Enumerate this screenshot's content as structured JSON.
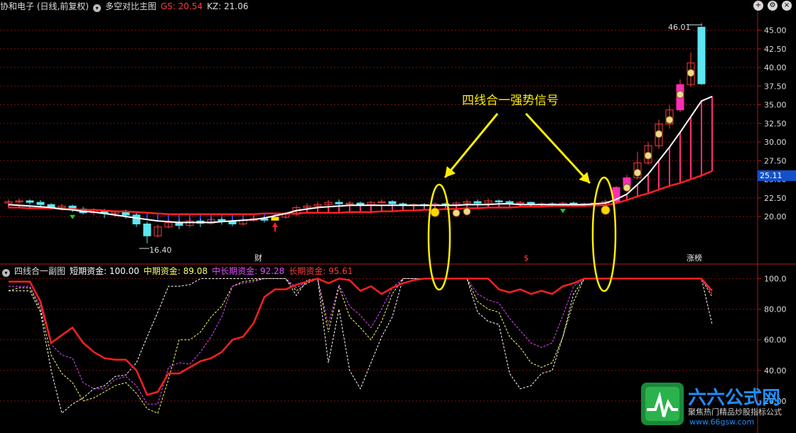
{
  "main_header": {
    "title": "协和电子 (日线,前复权)",
    "indicator": "多空对比主图",
    "gs_label": "GS: 20.54",
    "kz_label": "KZ: 21.06"
  },
  "sub_header": {
    "title": "四线合一副图",
    "short": "短期资金: 100.00",
    "mid": "中期资金: 89.08",
    "midlong": "中长期资金: 92.28",
    "long": "长期资金: 95.61"
  },
  "annotations": {
    "signal": "四线合一强势信号",
    "high": "46.01",
    "low": "16.40",
    "current_price": "25.11",
    "event_cai": "财",
    "event_s": "$",
    "event_zhangbang": "涨榜"
  },
  "watermark": {
    "brand": "六六公式网",
    "slogan": "聚焦热门精品炒股指标公式",
    "url": "www.66gsw.com"
  },
  "colors": {
    "bg": "#000000",
    "up": "#ff3b3b",
    "down": "#5ce6f2",
    "ma_white": "#ffffff",
    "ma_red": "#ff2020",
    "short": "#ff2020",
    "mid": "#ffff66",
    "midlong": "#e64cff",
    "long": "#ffffff",
    "annot": "#ffee00",
    "grid": "#7a1010"
  },
  "chart_data": [
    {
      "type": "candlestick",
      "title": "多空对比主图",
      "ylim": [
        15,
        48
      ],
      "yticks": [
        "20.00",
        "22.50",
        "25.00",
        "27.50",
        "30.00",
        "32.50",
        "35.00",
        "37.50",
        "40.00",
        "42.50",
        "45.00"
      ],
      "candles": [
        [
          21.8,
          22.0,
          22.3,
          21.5
        ],
        [
          22.0,
          22.1,
          22.4,
          21.7
        ],
        [
          22.1,
          21.9,
          22.3,
          21.6
        ],
        [
          21.9,
          21.6,
          22.2,
          21.3
        ],
        [
          21.6,
          21.2,
          21.8,
          20.9
        ],
        [
          21.2,
          21.4,
          21.7,
          20.8
        ],
        [
          21.4,
          21.0,
          21.6,
          20.6
        ],
        [
          21.0,
          20.5,
          21.3,
          20.3
        ],
        [
          20.5,
          20.8,
          21.1,
          20.2
        ],
        [
          20.8,
          20.4,
          21.0,
          19.8
        ],
        [
          20.4,
          20.6,
          20.8,
          19.9
        ],
        [
          20.6,
          20.2,
          20.9,
          19.7
        ],
        [
          20.2,
          19.0,
          20.4,
          18.6
        ],
        [
          19.0,
          17.4,
          19.3,
          16.4
        ],
        [
          17.4,
          18.6,
          18.9,
          17.2
        ],
        [
          18.6,
          19.2,
          19.6,
          18.4
        ],
        [
          19.2,
          18.8,
          19.5,
          18.3
        ],
        [
          18.8,
          19.4,
          19.8,
          18.5
        ],
        [
          19.4,
          19.1,
          19.7,
          18.6
        ],
        [
          19.1,
          19.6,
          19.9,
          18.9
        ],
        [
          19.6,
          19.3,
          19.8,
          18.9
        ],
        [
          19.3,
          19.0,
          19.6,
          18.7
        ],
        [
          19.0,
          19.5,
          19.8,
          18.8
        ],
        [
          19.5,
          19.7,
          20.1,
          19.3
        ],
        [
          19.7,
          19.5,
          20.0,
          19.2
        ],
        [
          19.5,
          19.9,
          20.2,
          19.4
        ],
        [
          19.9,
          20.3,
          20.6,
          19.7
        ],
        [
          20.3,
          21.2,
          21.5,
          20.1
        ],
        [
          21.2,
          21.4,
          21.8,
          20.9
        ],
        [
          21.4,
          21.6,
          22.0,
          21.2
        ],
        [
          21.6,
          21.9,
          22.2,
          21.4
        ],
        [
          21.9,
          21.7,
          22.3,
          21.5
        ],
        [
          21.7,
          21.8,
          22.1,
          21.5
        ],
        [
          21.8,
          21.6,
          22.0,
          21.4
        ],
        [
          21.6,
          21.9,
          22.1,
          21.5
        ],
        [
          21.9,
          22.0,
          22.3,
          21.7
        ],
        [
          22.0,
          21.7,
          22.2,
          21.5
        ],
        [
          21.7,
          21.5,
          21.9,
          21.3
        ],
        [
          21.5,
          21.6,
          21.8,
          21.3
        ],
        [
          21.6,
          21.5,
          21.8,
          21.3
        ],
        [
          21.5,
          21.7,
          21.9,
          21.3
        ],
        [
          21.7,
          21.6,
          21.9,
          21.4
        ],
        [
          21.6,
          21.8,
          22.0,
          21.4
        ],
        [
          21.8,
          22.0,
          22.3,
          21.6
        ],
        [
          22.0,
          21.8,
          22.3,
          21.5
        ],
        [
          21.8,
          22.1,
          22.4,
          21.6
        ],
        [
          22.1,
          22.0,
          22.3,
          21.8
        ],
        [
          22.0,
          21.8,
          22.2,
          21.6
        ],
        [
          21.8,
          21.9,
          22.1,
          21.6
        ],
        [
          21.9,
          21.6,
          22.0,
          21.4
        ],
        [
          21.6,
          21.7,
          21.9,
          21.4
        ],
        [
          21.7,
          21.6,
          21.9,
          21.4
        ],
        [
          21.6,
          21.8,
          22.0,
          21.4
        ],
        [
          21.8,
          21.6,
          22.0,
          21.4
        ],
        [
          21.6,
          21.7,
          21.9,
          21.5
        ],
        [
          21.7,
          21.8,
          22.0,
          21.5
        ],
        [
          21.8,
          22.0,
          22.3,
          21.6
        ],
        [
          22.0,
          23.9,
          24.1,
          21.9
        ],
        [
          23.9,
          25.2,
          25.6,
          23.4
        ],
        [
          25.2,
          27.2,
          28.7,
          25.0
        ],
        [
          27.2,
          29.5,
          30.0,
          26.9
        ],
        [
          29.5,
          32.4,
          33.0,
          29.1
        ],
        [
          32.4,
          34.3,
          34.9,
          31.8
        ],
        [
          34.3,
          37.7,
          38.4,
          34.0
        ],
        [
          37.7,
          40.6,
          42.0,
          37.4
        ],
        [
          37.8,
          45.4,
          46.01,
          37.6
        ]
      ],
      "ma_white": [
        21.6,
        21.5,
        21.4,
        21.3,
        21.2,
        21.0,
        20.9,
        20.7,
        20.6,
        20.4,
        20.2,
        20.0,
        19.8,
        19.6,
        19.4,
        19.3,
        19.2,
        19.2,
        19.2,
        19.2,
        19.3,
        19.4,
        19.5,
        19.6,
        19.8,
        20.1,
        20.4,
        20.8,
        21.0,
        21.2,
        21.3,
        21.4,
        21.5,
        21.5,
        21.5,
        21.5,
        21.5,
        21.5,
        21.5,
        21.5,
        21.5,
        21.5,
        21.5,
        21.6,
        21.6,
        21.6,
        21.7,
        21.7,
        21.6,
        21.6,
        21.6,
        21.6,
        21.6,
        21.6,
        21.6,
        21.7,
        21.8,
        22.3,
        23.0,
        24.3,
        25.7,
        27.5,
        29.3,
        31.3,
        33.4,
        35.5,
        36.1
      ],
      "ma_red": [
        21.2,
        21.2,
        21.1,
        21.1,
        21.1,
        21.0,
        21.0,
        20.9,
        20.9,
        20.8,
        20.7,
        20.7,
        20.6,
        20.5,
        20.4,
        20.3,
        20.3,
        20.3,
        20.3,
        20.3,
        20.3,
        20.3,
        20.3,
        20.3,
        20.4,
        20.4,
        20.4,
        20.4,
        20.5,
        20.5,
        20.5,
        20.5,
        20.6,
        20.6,
        20.6,
        20.7,
        20.7,
        20.8,
        20.8,
        20.9,
        20.9,
        21.0,
        21.0,
        21.1,
        21.1,
        21.2,
        21.2,
        21.2,
        21.3,
        21.3,
        21.3,
        21.4,
        21.4,
        21.4,
        21.4,
        21.5,
        21.5,
        21.8,
        22.2,
        22.7,
        23.1,
        23.6,
        24.1,
        24.5,
        25.0,
        25.5,
        26.1
      ]
    },
    {
      "type": "line",
      "title": "四线合一副图",
      "ylim": [
        0,
        110
      ],
      "yticks": [
        "20.00",
        "40.00",
        "60.00",
        "80.00",
        "100.0"
      ],
      "series": [
        {
          "name": "短期资金",
          "values": [
            98,
            98,
            98,
            85,
            58,
            63,
            68,
            58,
            52,
            48,
            47,
            47,
            40,
            24,
            26,
            38,
            38,
            42,
            46,
            48,
            52,
            60,
            62,
            71,
            88,
            93,
            93,
            96,
            98,
            100,
            97,
            100,
            99,
            92,
            95,
            90,
            94,
            97,
            99,
            100,
            100,
            100,
            100,
            100,
            100,
            100,
            93,
            91,
            93,
            90,
            92,
            90,
            95,
            97,
            100,
            100,
            100,
            100,
            100,
            100,
            100,
            100,
            100,
            100,
            100,
            100,
            92
          ]
        },
        {
          "name": "中期资金",
          "values": [
            92,
            94,
            94,
            80,
            50,
            38,
            32,
            20,
            22,
            26,
            30,
            32,
            25,
            15,
            12,
            34,
            60,
            60,
            65,
            75,
            82,
            95,
            98,
            99,
            100,
            100,
            100,
            92,
            97,
            100,
            65,
            95,
            75,
            68,
            60,
            72,
            90,
            100,
            100,
            100,
            100,
            100,
            100,
            100,
            85,
            80,
            78,
            62,
            55,
            45,
            42,
            45,
            62,
            85,
            100,
            100,
            100,
            100,
            100,
            100,
            100,
            100,
            100,
            100,
            100,
            100,
            88
          ]
        },
        {
          "name": "中长期资金",
          "values": [
            95,
            95,
            95,
            82,
            57,
            50,
            48,
            32,
            28,
            28,
            34,
            36,
            30,
            18,
            18,
            42,
            45,
            44,
            52,
            62,
            75,
            95,
            97,
            98,
            100,
            100,
            100,
            94,
            98,
            100,
            70,
            96,
            82,
            76,
            68,
            80,
            94,
            100,
            100,
            100,
            100,
            100,
            100,
            100,
            90,
            86,
            84,
            74,
            66,
            58,
            55,
            58,
            76,
            95,
            100,
            100,
            100,
            100,
            100,
            100,
            100,
            100,
            100,
            100,
            100,
            100,
            90
          ]
        },
        {
          "name": "长期资金",
          "values": [
            92,
            92,
            92,
            78,
            40,
            12,
            18,
            22,
            28,
            30,
            36,
            37,
            45,
            62,
            78,
            95,
            95,
            96,
            100,
            100,
            100,
            100,
            100,
            100,
            100,
            100,
            100,
            89,
            99,
            100,
            45,
            80,
            40,
            28,
            45,
            62,
            75,
            100,
            100,
            100,
            100,
            100,
            100,
            100,
            78,
            72,
            70,
            38,
            28,
            30,
            38,
            40,
            62,
            90,
            100,
            100,
            100,
            100,
            100,
            100,
            100,
            100,
            100,
            100,
            100,
            100,
            70
          ]
        }
      ]
    }
  ]
}
